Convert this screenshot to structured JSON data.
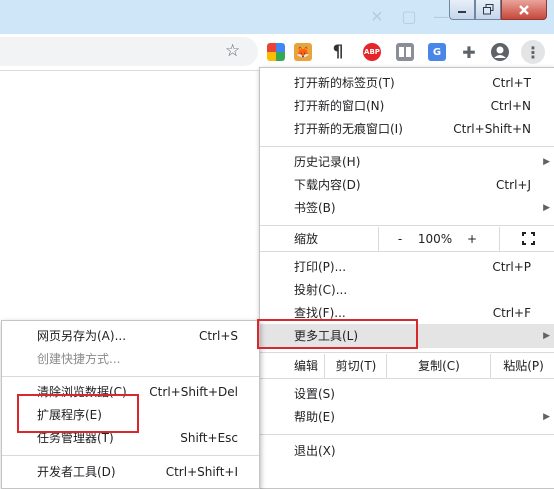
{
  "main_menu": {
    "new_tab": {
      "label": "打开新的标签页(T)",
      "shortcut": "Ctrl+T"
    },
    "new_window": {
      "label": "打开新的窗口(N)",
      "shortcut": "Ctrl+N"
    },
    "new_incognito": {
      "label": "打开新的无痕窗口(I)",
      "shortcut": "Ctrl+Shift+N"
    },
    "history": {
      "label": "历史记录(H)"
    },
    "downloads": {
      "label": "下载内容(D)",
      "shortcut": "Ctrl+J"
    },
    "bookmarks": {
      "label": "书签(B)"
    },
    "zoom": {
      "label": "缩放",
      "minus": "-",
      "value": "100%",
      "plus": "+"
    },
    "print": {
      "label": "打印(P)...",
      "shortcut": "Ctrl+P"
    },
    "cast": {
      "label": "投射(C)..."
    },
    "find": {
      "label": "查找(F)...",
      "shortcut": "Ctrl+F"
    },
    "more_tools": {
      "label": "更多工具(L)"
    },
    "edit": {
      "label": "编辑",
      "cut": "剪切(T)",
      "copy": "复制(C)",
      "paste": "粘贴(P)"
    },
    "settings": {
      "label": "设置(S)"
    },
    "help": {
      "label": "帮助(E)"
    },
    "exit": {
      "label": "退出(X)"
    }
  },
  "sub_menu": {
    "save_page": {
      "label": "网页另存为(A)...",
      "shortcut": "Ctrl+S"
    },
    "create_shortcut": {
      "label": "创建快捷方式..."
    },
    "clear_data": {
      "label": "清除浏览数据(C)...",
      "shortcut": "Ctrl+Shift+Del"
    },
    "extensions": {
      "label": "扩展程序(E)"
    },
    "task_manager": {
      "label": "任务管理器(T)",
      "shortcut": "Shift+Esc"
    },
    "dev_tools": {
      "label": "开发者工具(D)",
      "shortcut": "Ctrl+Shift+I"
    }
  },
  "toolbar": {
    "icons": [
      "bookmark-star-icon",
      "google-earth-icon",
      "fox-extension-icon",
      "paragraph-icon",
      "adblock-plus-icon",
      "tab-grid-icon",
      "google-translate-icon",
      "extensions-puzzle-icon",
      "profile-avatar-icon",
      "more-menu-icon"
    ],
    "abp_text": "ABP"
  },
  "colors": {
    "highlight_box": "#d9272e",
    "titlebar": "#cfe6f8",
    "hover": "#e4e4e4"
  }
}
